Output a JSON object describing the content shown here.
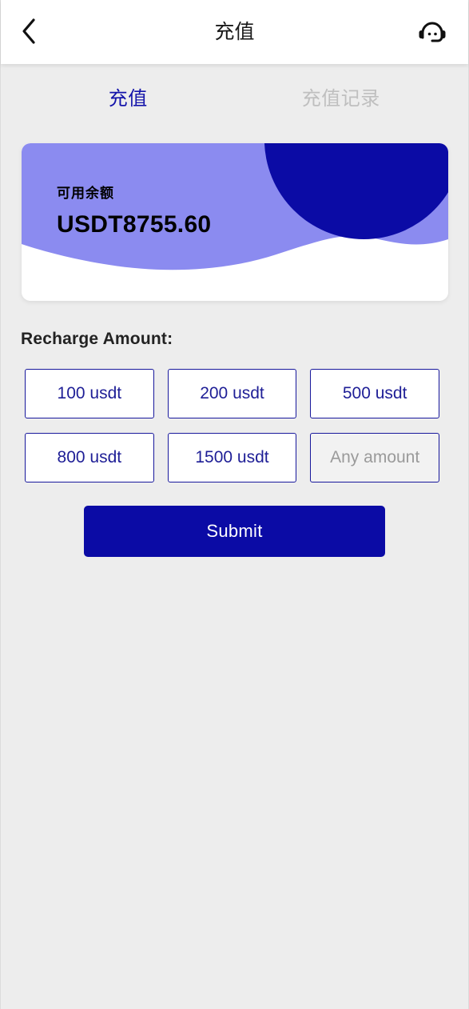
{
  "header": {
    "title": "充值",
    "back_icon": "chevron-left-icon",
    "support_icon": "customer-service-headset-icon"
  },
  "tabs": [
    {
      "label": "充值",
      "active": true
    },
    {
      "label": "充值记录",
      "active": false
    }
  ],
  "balance_card": {
    "label": "可用余额",
    "amount": "USDT8755.60",
    "colors": {
      "card_bg": "#ffffff",
      "wave": "#8b8bf0",
      "circle": "#0b0ba5"
    }
  },
  "recharge": {
    "section_title": "Recharge Amount:",
    "options": [
      {
        "label": "100 usdt",
        "type": "preset"
      },
      {
        "label": "200 usdt",
        "type": "preset"
      },
      {
        "label": "500 usdt",
        "type": "preset"
      },
      {
        "label": "800 usdt",
        "type": "preset"
      },
      {
        "label": "1500 usdt",
        "type": "preset"
      }
    ],
    "custom_amount": {
      "placeholder": "Any amount",
      "value": ""
    },
    "submit_label": "Submit"
  },
  "theme": {
    "page_bg": "#ededed",
    "accent_navy": "#0b0ba5",
    "accent_periwinkle": "#8b8bf0",
    "tab_active": "#1414aa",
    "tab_inactive": "#bfbfbf"
  }
}
